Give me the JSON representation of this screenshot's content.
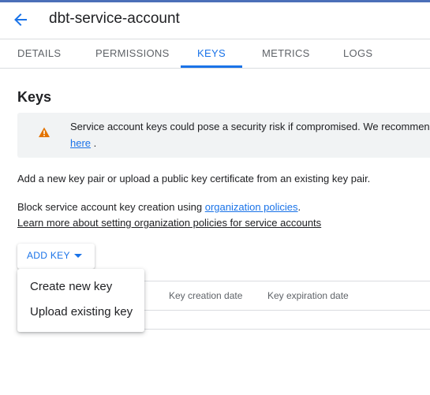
{
  "header": {
    "title": "dbt-service-account",
    "back_icon": "arrow-back-icon"
  },
  "tabs": [
    {
      "label": "DETAILS"
    },
    {
      "label": "PERMISSIONS"
    },
    {
      "label": "KEYS",
      "active": true
    },
    {
      "label": "METRICS"
    },
    {
      "label": "LOGS"
    }
  ],
  "keys_section": {
    "title": "Keys",
    "warning": {
      "text": "Service account keys could pose a security risk if compromised. We recommen",
      "link": "here",
      "link_suffix": " .",
      "icon": "warning-icon"
    },
    "intro_text": "Add a new key pair or upload a public key certificate from an existing key pair.",
    "block_text": "Block service account key creation using ",
    "block_link": "organization policies",
    "block_suffix": ".",
    "learn_more_link": "Learn more about setting organization policies for service accounts",
    "add_key_label": "ADD KEY"
  },
  "add_key_menu": {
    "items": [
      {
        "label": "Create new key"
      },
      {
        "label": "Upload existing key"
      }
    ]
  },
  "table": {
    "columns": [
      "Key creation date",
      "Key expiration date"
    ]
  },
  "colors": {
    "accent": "#1a73e8",
    "top_bar": "#4b6fb8",
    "warning": "#e37400"
  }
}
